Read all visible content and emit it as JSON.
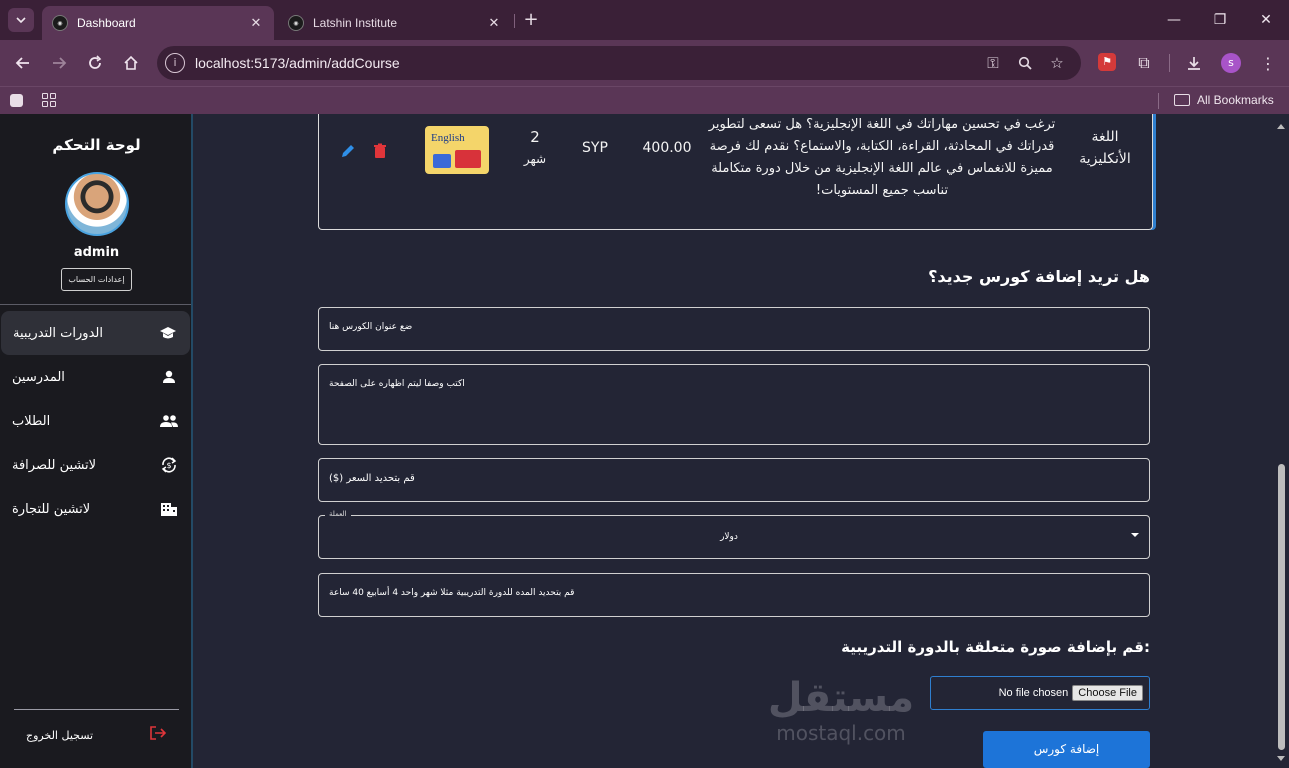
{
  "browser": {
    "tabs": [
      {
        "title": "Dashboard",
        "favicon": "latshin-logo-icon",
        "active": true
      },
      {
        "title": "Latshin Institute",
        "favicon": "latshin-logo-icon",
        "active": false
      }
    ],
    "url": "localhost:5173/admin/addCourse",
    "bookmarks_label": "All Bookmarks",
    "profile_initial": "s"
  },
  "sidebar": {
    "title": "لوحة التحكم",
    "username": "admin",
    "account_settings": "إعدادات الحساب",
    "items": [
      {
        "label": "الدورات التدريبية",
        "icon": "graduation-cap-icon",
        "active": true
      },
      {
        "label": "المدرسين",
        "icon": "person-icon",
        "active": false
      },
      {
        "label": "الطلاب",
        "icon": "people-icon",
        "active": false
      },
      {
        "label": "لاتشين للصرافة",
        "icon": "currency-exchange-icon",
        "active": false
      },
      {
        "label": "لاتشين للتجارة",
        "icon": "building-icon",
        "active": false
      }
    ],
    "logout": "تسجيل الخروج"
  },
  "course_row": {
    "name": "اللغة الأنكليزية",
    "description": "ترغب في تحسين مهاراتك في اللغة الإنجليزية؟ هل تسعى لتطوير قدراتك في المحادثة، القراءة، الكتابة، والاستماع؟ نقدم لك فرصة مميزة للانغماس في عالم اللغة الإنجليزية من خلال دورة متكاملة تناسب جميع المستويات!",
    "price": "400.00",
    "currency": "SYP",
    "duration_value": "2",
    "duration_unit": "شهر",
    "thumbnail_text": "English"
  },
  "form": {
    "title": "هل تريد إضافة كورس جديد؟",
    "title_placeholder": "ضع عنوان الكورس هنا",
    "description_placeholder": "اكتب وصفا ليتم اظهاره على الصفحة",
    "price_placeholder": "قم بتحديد السعر ($)",
    "currency_label": "العملة",
    "currency_value": "دولار",
    "duration_placeholder": "قم بتحديد المده للدورة التدريبية مثلا شهر واحد 4 أسابيع 40 ساعة",
    "image_title": ":قم بإضافة صورة متعلقة بالدورة التدريبية",
    "file_button": "Choose File",
    "file_status": "No file chosen",
    "submit": "إضافة كورس"
  },
  "watermark": {
    "arabic": "مستقل",
    "latin": "mostaql.com"
  },
  "colors": {
    "accent": "#1d74d8",
    "sidebar_bg": "#1a1a1f",
    "page_bg": "#232535",
    "delete": "#e0353a",
    "edit": "#2f8fe8"
  }
}
